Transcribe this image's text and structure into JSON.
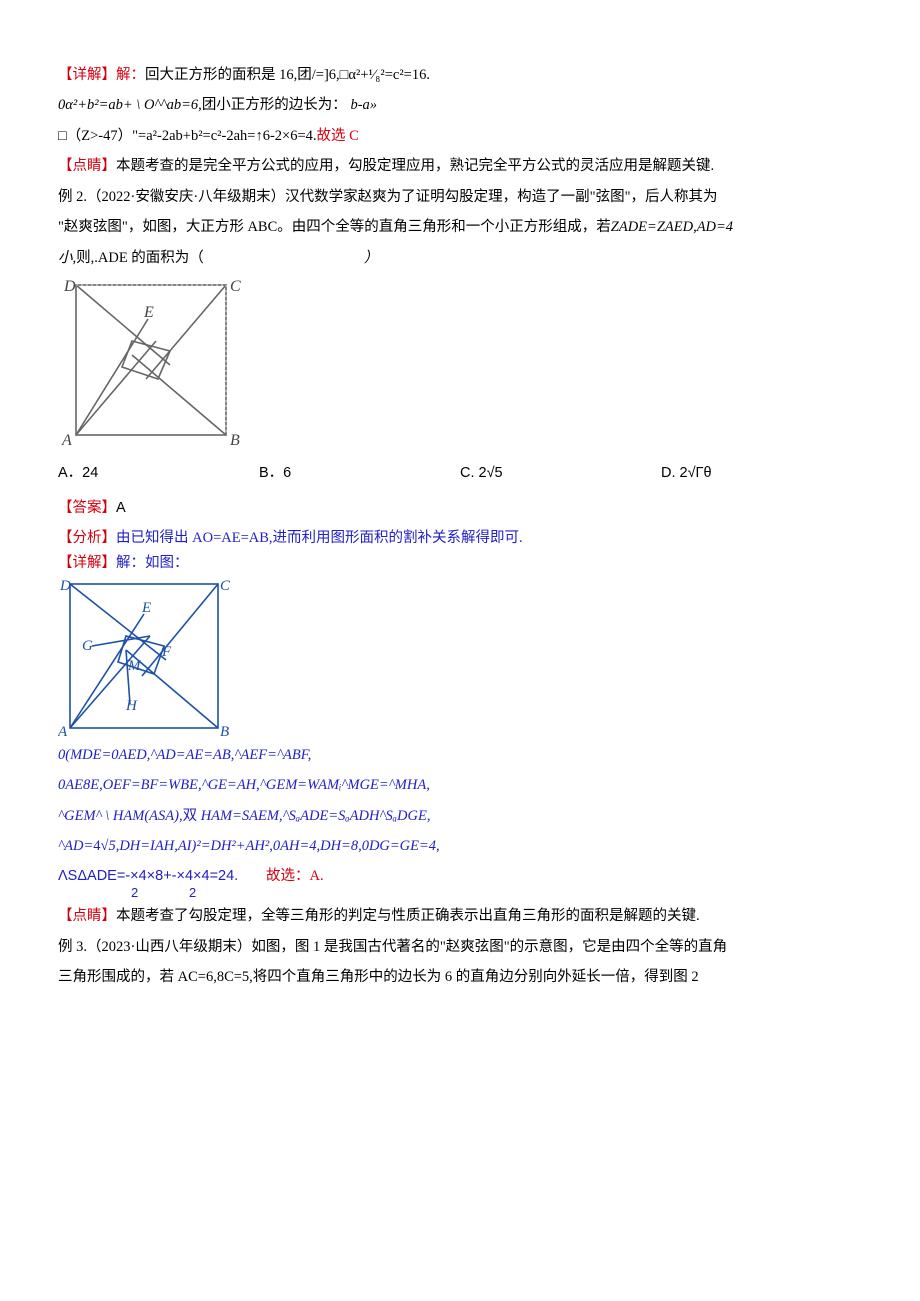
{
  "l1_a": "【详解】解：",
  "l1_b": "回大正方形的面积是 16,团/=]6,□α²+¹⁄₈²=c²=16.",
  "l2": "0α²+b²=ab+ \\ O^^ab=6,",
  "l2b": "团小正方形的边长为：",
  "l2c": "b-a»",
  "l3a": "□（Z>-47）\"=a²-2ab+b²=c²-2ah=↑6-2×6=4.",
  "l3b": "故选 C",
  "l4a": "【点睛】",
  "l4b": "本题考查的是完全平方公式的应用，勾股定理应用，熟记完全平方公式的灵活应用是解题关键.",
  "l5": "例 2.（2022·安徽安庆·八年级期末）汉代数学家赵爽为了证明勾股定理，构造了一副\"弦图\"，后人称其为",
  "l6a": "\"赵爽弦图\"，如图，大正方形 ABC。由四个全等的直角三角形和一个小正方形组成，若",
  "l6b": "ZADE=ZAED,AD=4",
  "l7a": "小,",
  "l7b": "则,.ADE 的面积为（",
  "l7c": "）",
  "optA": "A．24",
  "optB": "B．6",
  "optC": "C. 2√5",
  "optD": "D. 2√Γθ",
  "ans_a": "【答案】",
  "ans_b": "A",
  "l8a": "【分析】",
  "l8b": "由已知得出 AO=AE=AB,进而利用图形面积的割补关系解得即可.",
  "l9a": "【详解】",
  "l9b": "解：如图：",
  "l10": "0(MDE=0AED,^AD=AE=AB,^AEF=^ABF,",
  "l11": "0AE8E,OEF=BF=WBE,^GE=AH,^GEM=WAMᵢ^MGE=^MHA,",
  "l12a": "^GEM^ \\ HAM(ASA),",
  "l12b": "双",
  "l12c": "HAM=SAEM,^SₐADE=SₐADH^SₐDGE,",
  "l13a": "^AD=",
  "l13b": "4",
  "l13c": "√5,DH=IAH,AI)²=DH²+AH²",
  "l13d": ",",
  "l13e": "0AH=4,DH=8,0DG=GE=4,",
  "l14a": "ΛSΔADE=-×4×8+-×4×4=24.",
  "l14b": "故选：A.",
  "l14_den1": "2",
  "l14_den2": "2",
  "l15a": "【点睛】",
  "l15b": "本题考查了勾股定理，全等三角形的判定与性质正确表示出直角三角形的面积是解题的关键.",
  "l16": "例 3.（2023·山西八年级期末）如图，图 1 是我国古代著名的\"赵爽弦图\"的示意图，它是由四个全等的直角",
  "l17": "三角形围成的，若 AC=6,8C=5,将四个直角三角形中的边长为 6 的直角边分别向外延长一倍，得到图 2"
}
